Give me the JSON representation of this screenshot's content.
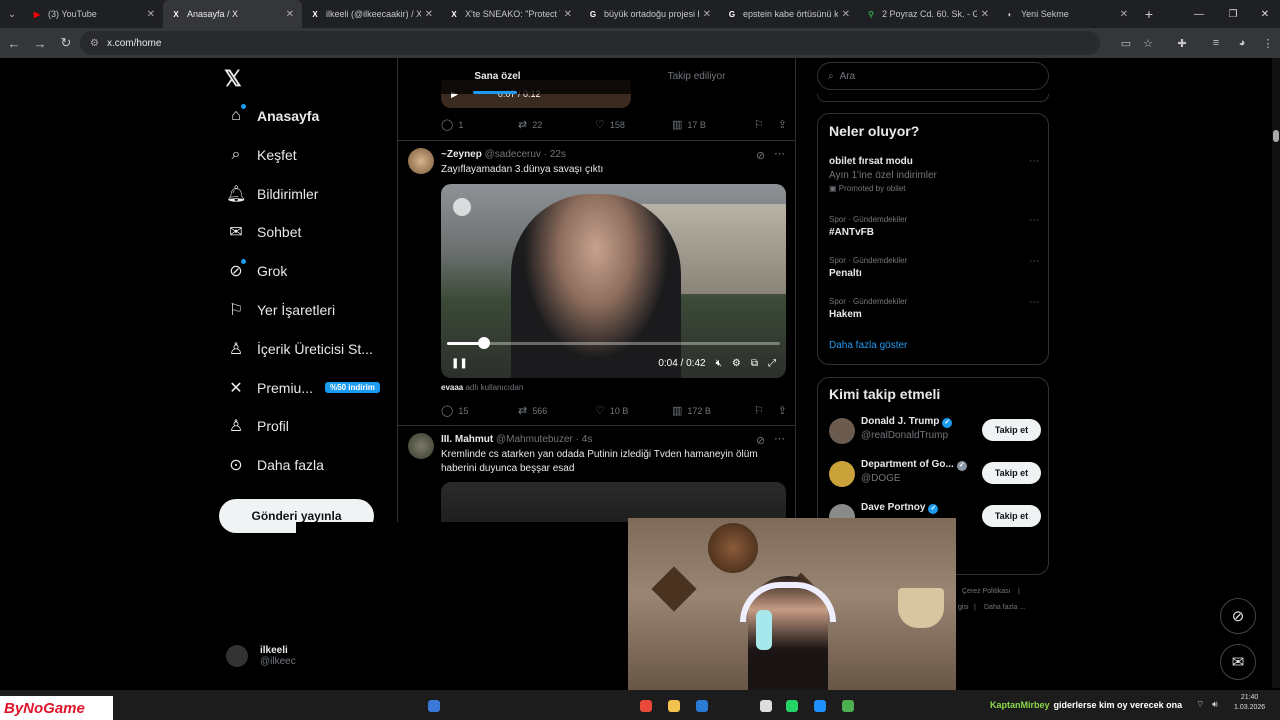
{
  "browser": {
    "tabs": [
      {
        "title": "(3) YouTube",
        "color": "#ff0000",
        "glyph": "▶"
      },
      {
        "title": "Anasayfa / X",
        "color": "#ffffff",
        "glyph": "X",
        "active": true
      },
      {
        "title": "ilkeeli (@ilkeecaakir) / X",
        "color": "#ffffff",
        "glyph": "X"
      },
      {
        "title": "X'te SNEAKO: \"Protect Tu",
        "color": "#ffffff",
        "glyph": "X"
      },
      {
        "title": "büyük ortadoğu projesi h",
        "color": "#ffffff",
        "glyph": "G"
      },
      {
        "title": "epstein kabe örtüsünü kir",
        "color": "#ffffff",
        "glyph": "G"
      },
      {
        "title": "2 Poyraz Cd. 60. Sk. - Goo",
        "color": "#34a853",
        "glyph": "⚲"
      },
      {
        "title": "Yeni Sekme",
        "color": "#cccccc",
        "glyph": "◐"
      }
    ],
    "new_tab": "+",
    "url": "x.com/home"
  },
  "sidebar": {
    "logo": "𝕏",
    "items": [
      {
        "label": "Anasayfa",
        "icon": "home-icon",
        "glyph": "⌂",
        "bold": true,
        "dot": true
      },
      {
        "label": "Keşfet",
        "icon": "search-icon",
        "glyph": "⌕"
      },
      {
        "label": "Bildirimler",
        "icon": "bell-icon",
        "glyph": "🔔︎"
      },
      {
        "label": "Sohbet",
        "icon": "mail-icon",
        "glyph": "✉"
      },
      {
        "label": "Grok",
        "icon": "grok-icon",
        "glyph": "⊘",
        "dot": true
      },
      {
        "label": "Yer İşaretleri",
        "icon": "bookmark-icon",
        "glyph": "⚐"
      },
      {
        "label": "İçerik Üreticisi St...",
        "icon": "creator-icon",
        "glyph": "♙"
      },
      {
        "label": "Premiu...",
        "icon": "x-premium-icon",
        "glyph": "✕",
        "promo": "%50 indirim"
      },
      {
        "label": "Profil",
        "icon": "profile-icon",
        "glyph": "♙"
      },
      {
        "label": "Daha fazla",
        "icon": "more-circle-icon",
        "glyph": "⊙"
      }
    ],
    "post_button": "Gönderi yayınla",
    "account": {
      "name": "ilkeeli",
      "handle": "@ilkeec"
    }
  },
  "feed": {
    "tabs": [
      "Sana özel",
      "Takip ediliyor"
    ],
    "top_video_time": "0:07 / 0:12",
    "posts": [
      {
        "replies": "1",
        "reposts": "22",
        "likes": "158",
        "views": "17 B"
      },
      {
        "name": "~Zeynep",
        "handle": "@sadeceruv",
        "time": "· 22s",
        "text": "Zayıflayamadan 3.dünya savaşı çıktı",
        "video_time": "0:04 / 0:42",
        "video_progress": 0.11,
        "credit_user": "evaaa",
        "credit_suffix": "adlı kullanıcıdan",
        "replies": "15",
        "reposts": "566",
        "likes": "10 B",
        "views": "172 B"
      },
      {
        "name": "III. Mahmut",
        "handle": "@Mahmutebuzer",
        "time": "· 4s",
        "text": "Kremlinde cs atarken yan odada Putinin izlediği Tvden hamaneyin ölüm haberini duyunca beşşar esad"
      }
    ]
  },
  "right": {
    "search_placeholder": "Ara",
    "trends_title": "Neler oluyor?",
    "trends": [
      {
        "context": "",
        "topic": "obilet fırsat modu",
        "sub": "Ayın 1'ine özel indirimler",
        "promoted": "Promoted by obilet"
      },
      {
        "context": "Spor · Gündemdekiler",
        "topic": "#ANTvFB"
      },
      {
        "context": "Spor · Gündemdekiler",
        "topic": "Penaltı"
      },
      {
        "context": "Spor · Gündemdekiler",
        "topic": "Hakem"
      }
    ],
    "show_more": "Daha fazla göster",
    "who_title": "Kimi takip etmeli",
    "who": [
      {
        "name": "Donald J. Trump",
        "handle": "@realDonaldTrump",
        "button": "Takip et",
        "color": "#6b5a4e"
      },
      {
        "name": "Department of Go...",
        "handle": "@DOGE",
        "button": "Takip et",
        "color": "#c9a23a"
      },
      {
        "name": "Dave Portnoy",
        "handle": "",
        "button": "Takip et",
        "color": "#8a8a8a"
      }
    ],
    "footer": [
      "Çerez Politikası",
      "|",
      "gisi",
      "|",
      "Daha fazla ..."
    ]
  },
  "stream": {
    "brand": "ByNoGame",
    "chat_user": "KaptanMirbey",
    "chat_message": "giderlerse kim oy verecek ona",
    "clock_time": "21:40",
    "clock_date": "1.03.2026"
  }
}
